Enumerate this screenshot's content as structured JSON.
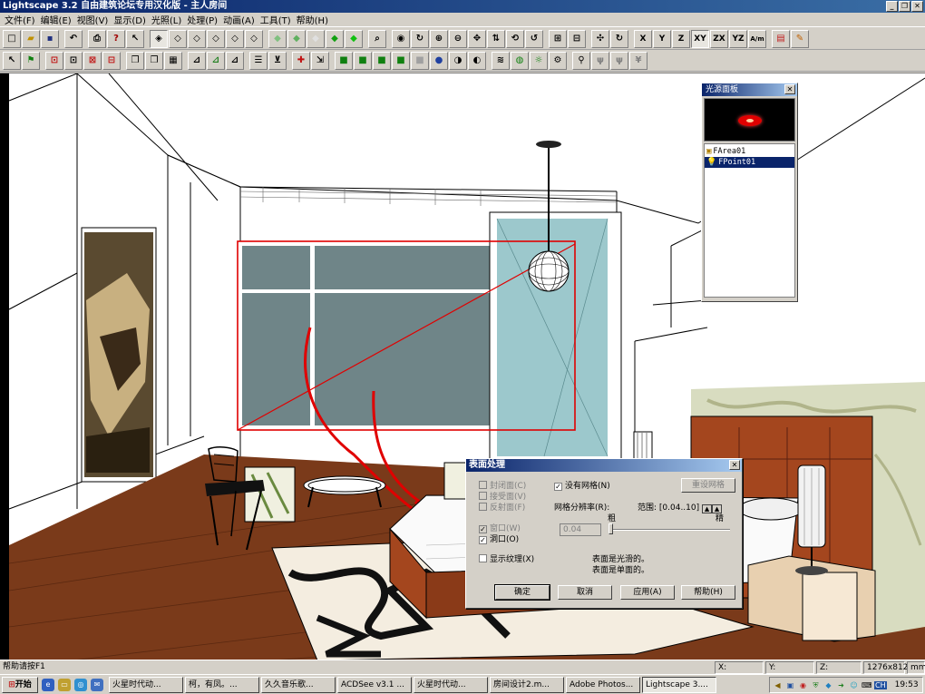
{
  "window": {
    "title": "Lightscape 3.2 自由建筑论坛专用汉化版 - 主人房间",
    "minimize": "_",
    "restore": "❐",
    "close": "✕"
  },
  "menu": [
    "文件(F)",
    "编辑(E)",
    "视图(V)",
    "显示(D)",
    "光照(L)",
    "处理(P)",
    "动画(A)",
    "工具(T)",
    "帮助(H)"
  ],
  "toolbar1": {
    "axis_buttons": [
      "X",
      "Y",
      "Z",
      "XY",
      "ZX",
      "YZ",
      "A/m"
    ]
  },
  "light_panel": {
    "title": "光源面板",
    "close": "✕",
    "items": [
      {
        "name": "FArea01",
        "icon": "▣",
        "selected": false
      },
      {
        "name": "FPoint01",
        "icon": "💡",
        "selected": true
      }
    ]
  },
  "dialog": {
    "title": "表面处理",
    "close": "✕",
    "checkboxes": {
      "closed_face": {
        "label": "封闭面(C)",
        "checked": false,
        "enabled": false
      },
      "receive_face": {
        "label": "接受面(V)",
        "checked": false,
        "enabled": false
      },
      "reflect_face": {
        "label": "反射面(F)",
        "checked": false,
        "enabled": false
      },
      "window": {
        "label": "窗口(W)",
        "checked": true,
        "enabled": false
      },
      "opening": {
        "label": "洞口(O)",
        "checked": true,
        "enabled": true
      },
      "show_texture": {
        "label": "显示纹理(X)",
        "checked": false,
        "enabled": true
      },
      "no_mesh": {
        "label": "没有网格(N)",
        "checked": true,
        "enabled": true
      }
    },
    "reset_mesh": "重设网格",
    "mesh_resolution_label": "网格分辨率(R):",
    "range_label": "范围: [0.04..10]",
    "coarse": "粗",
    "fine": "精",
    "resolution_value": "0.04",
    "info_line1": "表面是光滑的。",
    "info_line2": "表面是单面的。",
    "buttons": {
      "ok": "确定",
      "cancel": "取消",
      "apply": "应用(A)",
      "help": "帮助(H)"
    }
  },
  "status": {
    "help": "帮助请按F1",
    "x_label": "X:",
    "y_label": "Y:",
    "z_label": "Z:",
    "resolution": "1276x812",
    "unit": "mm"
  },
  "taskbar": {
    "start": "开始",
    "tasks": [
      {
        "label": "火星时代动...",
        "active": false
      },
      {
        "label": "柯，有凤。...",
        "active": false
      },
      {
        "label": "久久音乐歌...",
        "active": false
      },
      {
        "label": "ACDSee v3.1 ...",
        "active": false
      },
      {
        "label": "火星时代动...",
        "active": false
      },
      {
        "label": "房间设计2.m...",
        "active": false
      },
      {
        "label": "Adobe Photos...",
        "active": false
      },
      {
        "label": "Lightscape 3....",
        "active": true
      }
    ],
    "clock": "19:53",
    "lang": "CH"
  },
  "colors": {
    "title_start": "#0a246a",
    "title_end": "#a6caf0",
    "window_glass": "#6f8588",
    "glass_door": "#9cc8cc",
    "floor": "#7a3a1a",
    "selection_red": "#e00000"
  }
}
